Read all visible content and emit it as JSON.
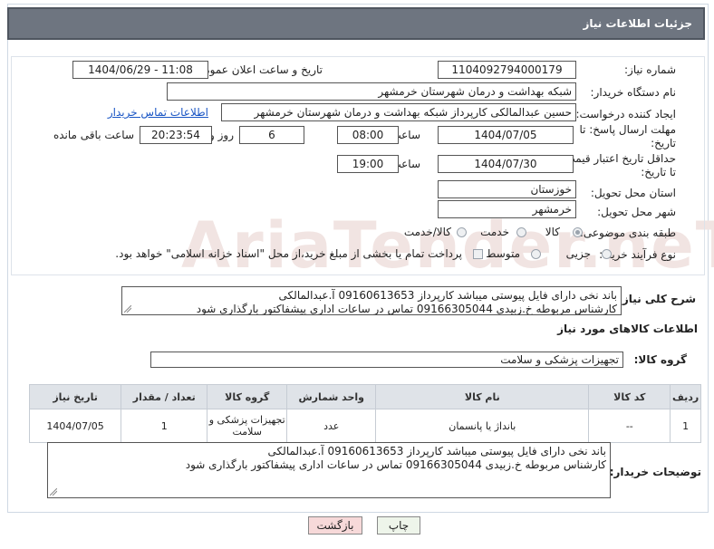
{
  "header": {
    "title": "جزئیات اطلاعات نیاز"
  },
  "fields": {
    "need_number_label": "شماره نیاز:",
    "need_number": "1104092794000179",
    "announce_label": "تاریخ و ساعت اعلان عمومی:",
    "announce_value": "1404/06/29 - 11:08",
    "buyer_org_label": "نام دستگاه خریدار:",
    "buyer_org": "شبکه بهداشت و درمان شهرستان خرمشهر",
    "creator_label": "ایجاد کننده درخواست:",
    "creator": "حسین عبدالمالکی کارپرداز شبکه بهداشت و درمان شهرستان خرمشهر",
    "contact_link": "اطلاعات تماس خریدار",
    "deadline_label_1": "مهلت ارسال پاسخ: تا",
    "deadline_label_2": "تاریخ:",
    "deadline_date": "1404/07/05",
    "time_label": "ساعت",
    "deadline_time": "08:00",
    "days": "6",
    "days_label": "روز و",
    "remaining": "20:23:54",
    "remaining_label": "ساعت باقی مانده",
    "validity_label_1": "حداقل تاریخ اعتبار قیمت:",
    "validity_label_2": "تا تاریخ:",
    "validity_date": "1404/07/30",
    "validity_time": "19:00",
    "province_label": "استان محل تحویل:",
    "province": "خوزستان",
    "city_label": "شهر محل تحویل:",
    "city": "خرمشهر",
    "category_label": "طبقه بندی موضوعی:",
    "category_options": [
      "کالا",
      "خدمت",
      "کالا/خدمت"
    ],
    "process_label": "نوع فرآیند خرید :",
    "process_options": [
      "جزیی",
      "متوسط"
    ],
    "payment_note": "پرداخت تمام یا بخشی از مبلغ خرید،از محل \"اسناد خزانه اسلامی\" خواهد بود."
  },
  "description": {
    "label": "شرح کلی نیاز:",
    "line1": "باند نخی دارای فایل پیوستی میباشد کارپرداز 09160613653 آ.عبدالمالکی",
    "line2": "کارشناس مربوطه خ.زبیدی 09166305044 تماس در ساعات اداری پیشفاکتور بارگذاری شود"
  },
  "goods": {
    "section_title": "اطلاعات کالاهای مورد نیاز",
    "group_label": "گروه کالا:",
    "group_value": "تجهیزات پزشکی و سلامت",
    "columns": [
      "ردیف",
      "کد کالا",
      "نام کالا",
      "واحد شمارش",
      "گروه کالا",
      "تعداد / مقدار",
      "تاریخ نیاز"
    ],
    "rows": [
      {
        "row": "1",
        "code": "--",
        "name": "بانداژ یا پانسمان",
        "unit": "عدد",
        "group": "تجهیزات پزشکی و سلامت",
        "qty": "1",
        "date": "1404/07/05"
      }
    ]
  },
  "buyer_notes": {
    "label": "توضیحات خریدار:",
    "line1": "باند نخی دارای فایل پیوستی میباشد کارپرداز 09160613653 آ.عبدالمالکی",
    "line2": "کارشناس مربوطه خ.زبیدی 09166305044 تماس در ساعات اداری پیشفاکتور بارگذاری شود"
  },
  "buttons": {
    "print": "چاپ",
    "back": "بازگشت"
  },
  "watermark": "AriaTender.neT",
  "colors": {
    "header_bg": "#6e7580",
    "link": "#1a56c5",
    "back_btn_bg": "#f7d9d9"
  }
}
